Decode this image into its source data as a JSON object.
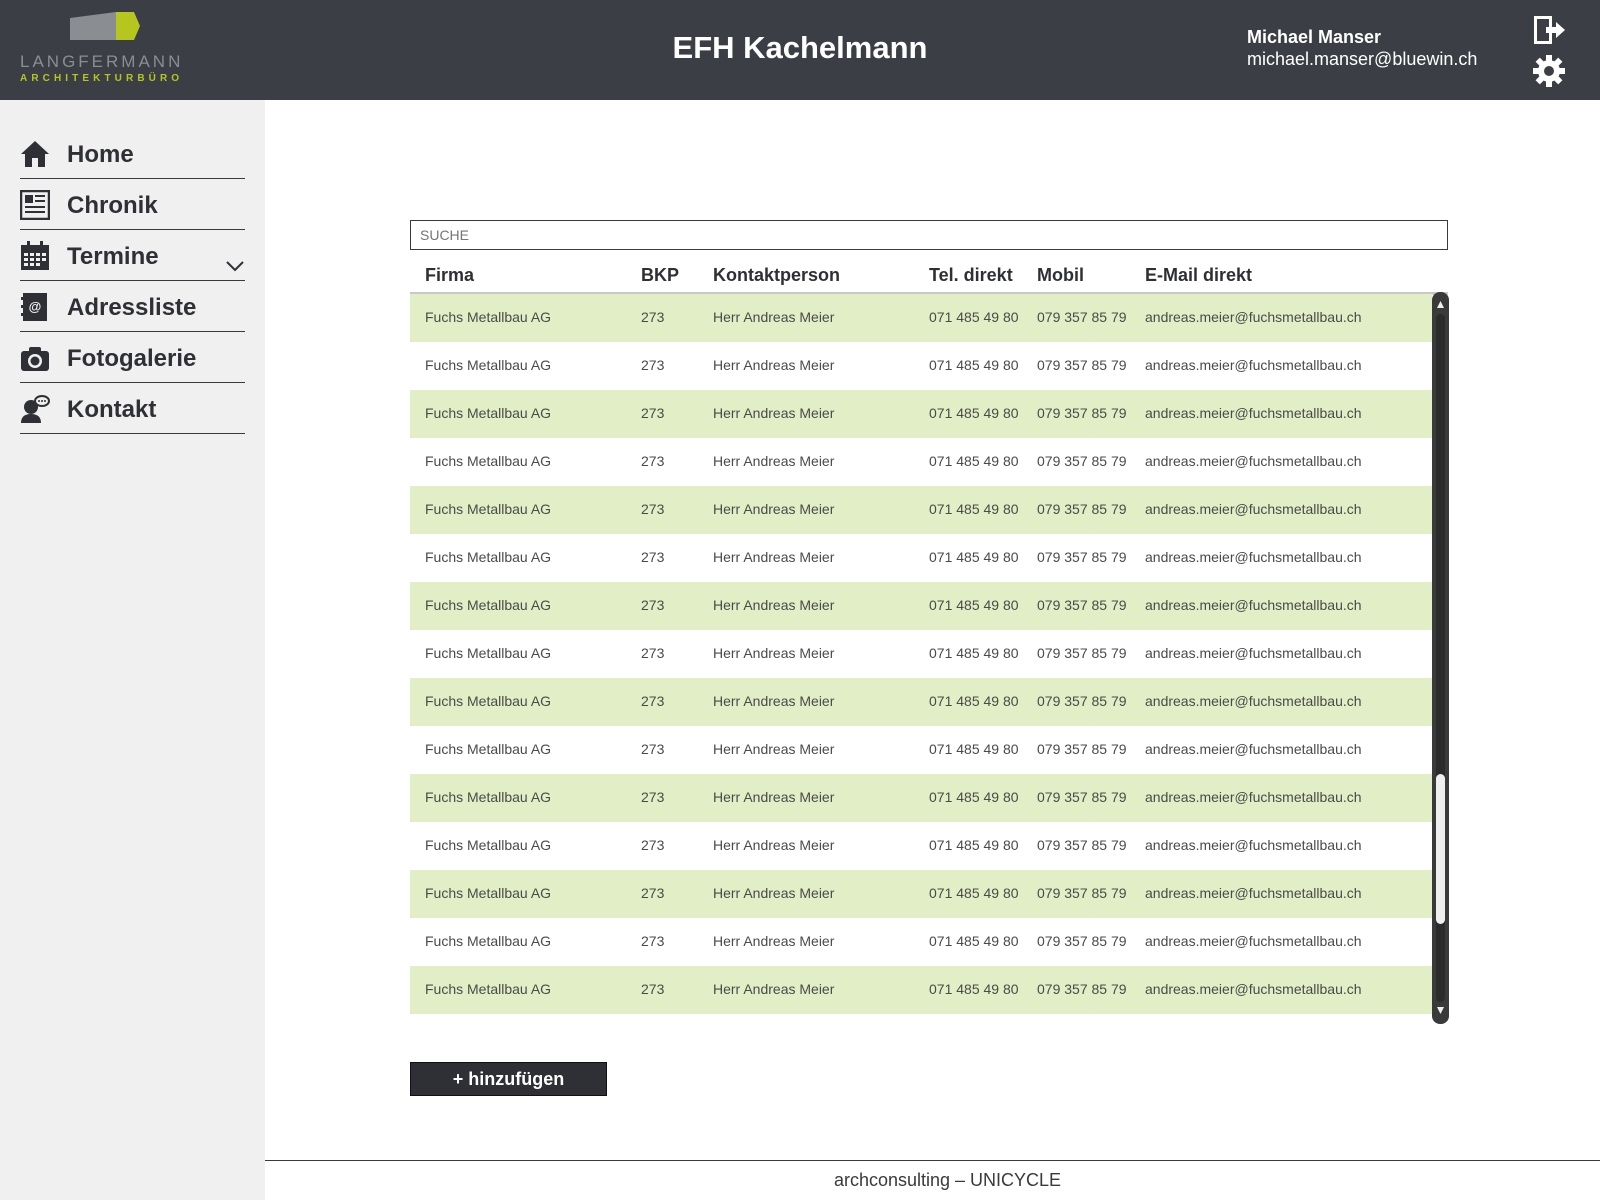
{
  "header": {
    "logo_name": "LANGFERMANN",
    "logo_subtitle": "ARCHITEKTURBÜRO",
    "title": "EFH Kachelmann",
    "user_name": "Michael Manser",
    "user_email": "michael.manser@bluewin.ch",
    "icons": [
      "logout-icon",
      "gear-icon"
    ]
  },
  "sidebar": {
    "items": [
      {
        "label": "Home",
        "icon": "home-icon"
      },
      {
        "label": "Chronik",
        "icon": "newspaper-icon"
      },
      {
        "label": "Termine",
        "icon": "calendar-icon",
        "expandable": true
      },
      {
        "label": "Adressliste",
        "icon": "address-book-icon"
      },
      {
        "label": "Fotogalerie",
        "icon": "camera-icon"
      },
      {
        "label": "Kontakt",
        "icon": "contact-speech-icon"
      }
    ]
  },
  "search": {
    "placeholder": "SUCHE"
  },
  "table": {
    "columns": [
      "Firma",
      "BKP",
      "Kontaktperson",
      "Tel. direkt",
      "Mobil",
      "E-Mail direkt"
    ],
    "rows": [
      [
        "Fuchs Metallbau AG",
        "273",
        "Herr Andreas Meier",
        "071 485 49 80",
        "079 357 85 79",
        "andreas.meier@fuchsmetallbau.ch"
      ],
      [
        "Fuchs Metallbau AG",
        "273",
        "Herr Andreas Meier",
        "071 485 49 80",
        "079 357 85 79",
        "andreas.meier@fuchsmetallbau.ch"
      ],
      [
        "Fuchs Metallbau AG",
        "273",
        "Herr Andreas Meier",
        "071 485 49 80",
        "079 357 85 79",
        "andreas.meier@fuchsmetallbau.ch"
      ],
      [
        "Fuchs Metallbau AG",
        "273",
        "Herr Andreas Meier",
        "071 485 49 80",
        "079 357 85 79",
        "andreas.meier@fuchsmetallbau.ch"
      ],
      [
        "Fuchs Metallbau AG",
        "273",
        "Herr Andreas Meier",
        "071 485 49 80",
        "079 357 85 79",
        "andreas.meier@fuchsmetallbau.ch"
      ],
      [
        "Fuchs Metallbau AG",
        "273",
        "Herr Andreas Meier",
        "071 485 49 80",
        "079 357 85 79",
        "andreas.meier@fuchsmetallbau.ch"
      ],
      [
        "Fuchs Metallbau AG",
        "273",
        "Herr Andreas Meier",
        "071 485 49 80",
        "079 357 85 79",
        "andreas.meier@fuchsmetallbau.ch"
      ],
      [
        "Fuchs Metallbau AG",
        "273",
        "Herr Andreas Meier",
        "071 485 49 80",
        "079 357 85 79",
        "andreas.meier@fuchsmetallbau.ch"
      ],
      [
        "Fuchs Metallbau AG",
        "273",
        "Herr Andreas Meier",
        "071 485 49 80",
        "079 357 85 79",
        "andreas.meier@fuchsmetallbau.ch"
      ],
      [
        "Fuchs Metallbau AG",
        "273",
        "Herr Andreas Meier",
        "071 485 49 80",
        "079 357 85 79",
        "andreas.meier@fuchsmetallbau.ch"
      ],
      [
        "Fuchs Metallbau AG",
        "273",
        "Herr Andreas Meier",
        "071 485 49 80",
        "079 357 85 79",
        "andreas.meier@fuchsmetallbau.ch"
      ],
      [
        "Fuchs Metallbau AG",
        "273",
        "Herr Andreas Meier",
        "071 485 49 80",
        "079 357 85 79",
        "andreas.meier@fuchsmetallbau.ch"
      ],
      [
        "Fuchs Metallbau AG",
        "273",
        "Herr Andreas Meier",
        "071 485 49 80",
        "079 357 85 79",
        "andreas.meier@fuchsmetallbau.ch"
      ],
      [
        "Fuchs Metallbau AG",
        "273",
        "Herr Andreas Meier",
        "071 485 49 80",
        "079 357 85 79",
        "andreas.meier@fuchsmetallbau.ch"
      ],
      [
        "Fuchs Metallbau AG",
        "273",
        "Herr Andreas Meier",
        "071 485 49 80",
        "079 357 85 79",
        "andreas.meier@fuchsmetallbau.ch"
      ]
    ]
  },
  "actions": {
    "add_label": "+ hinzufügen"
  },
  "footer": {
    "text": "archconsulting – UNICYCLE"
  },
  "colors": {
    "header_bg": "#3b3e44",
    "sidebar_bg": "#f0f0f0",
    "row_alt_bg": "#e2efc6",
    "accent_green": "#b5c61f",
    "text_dark": "#2e3035"
  }
}
